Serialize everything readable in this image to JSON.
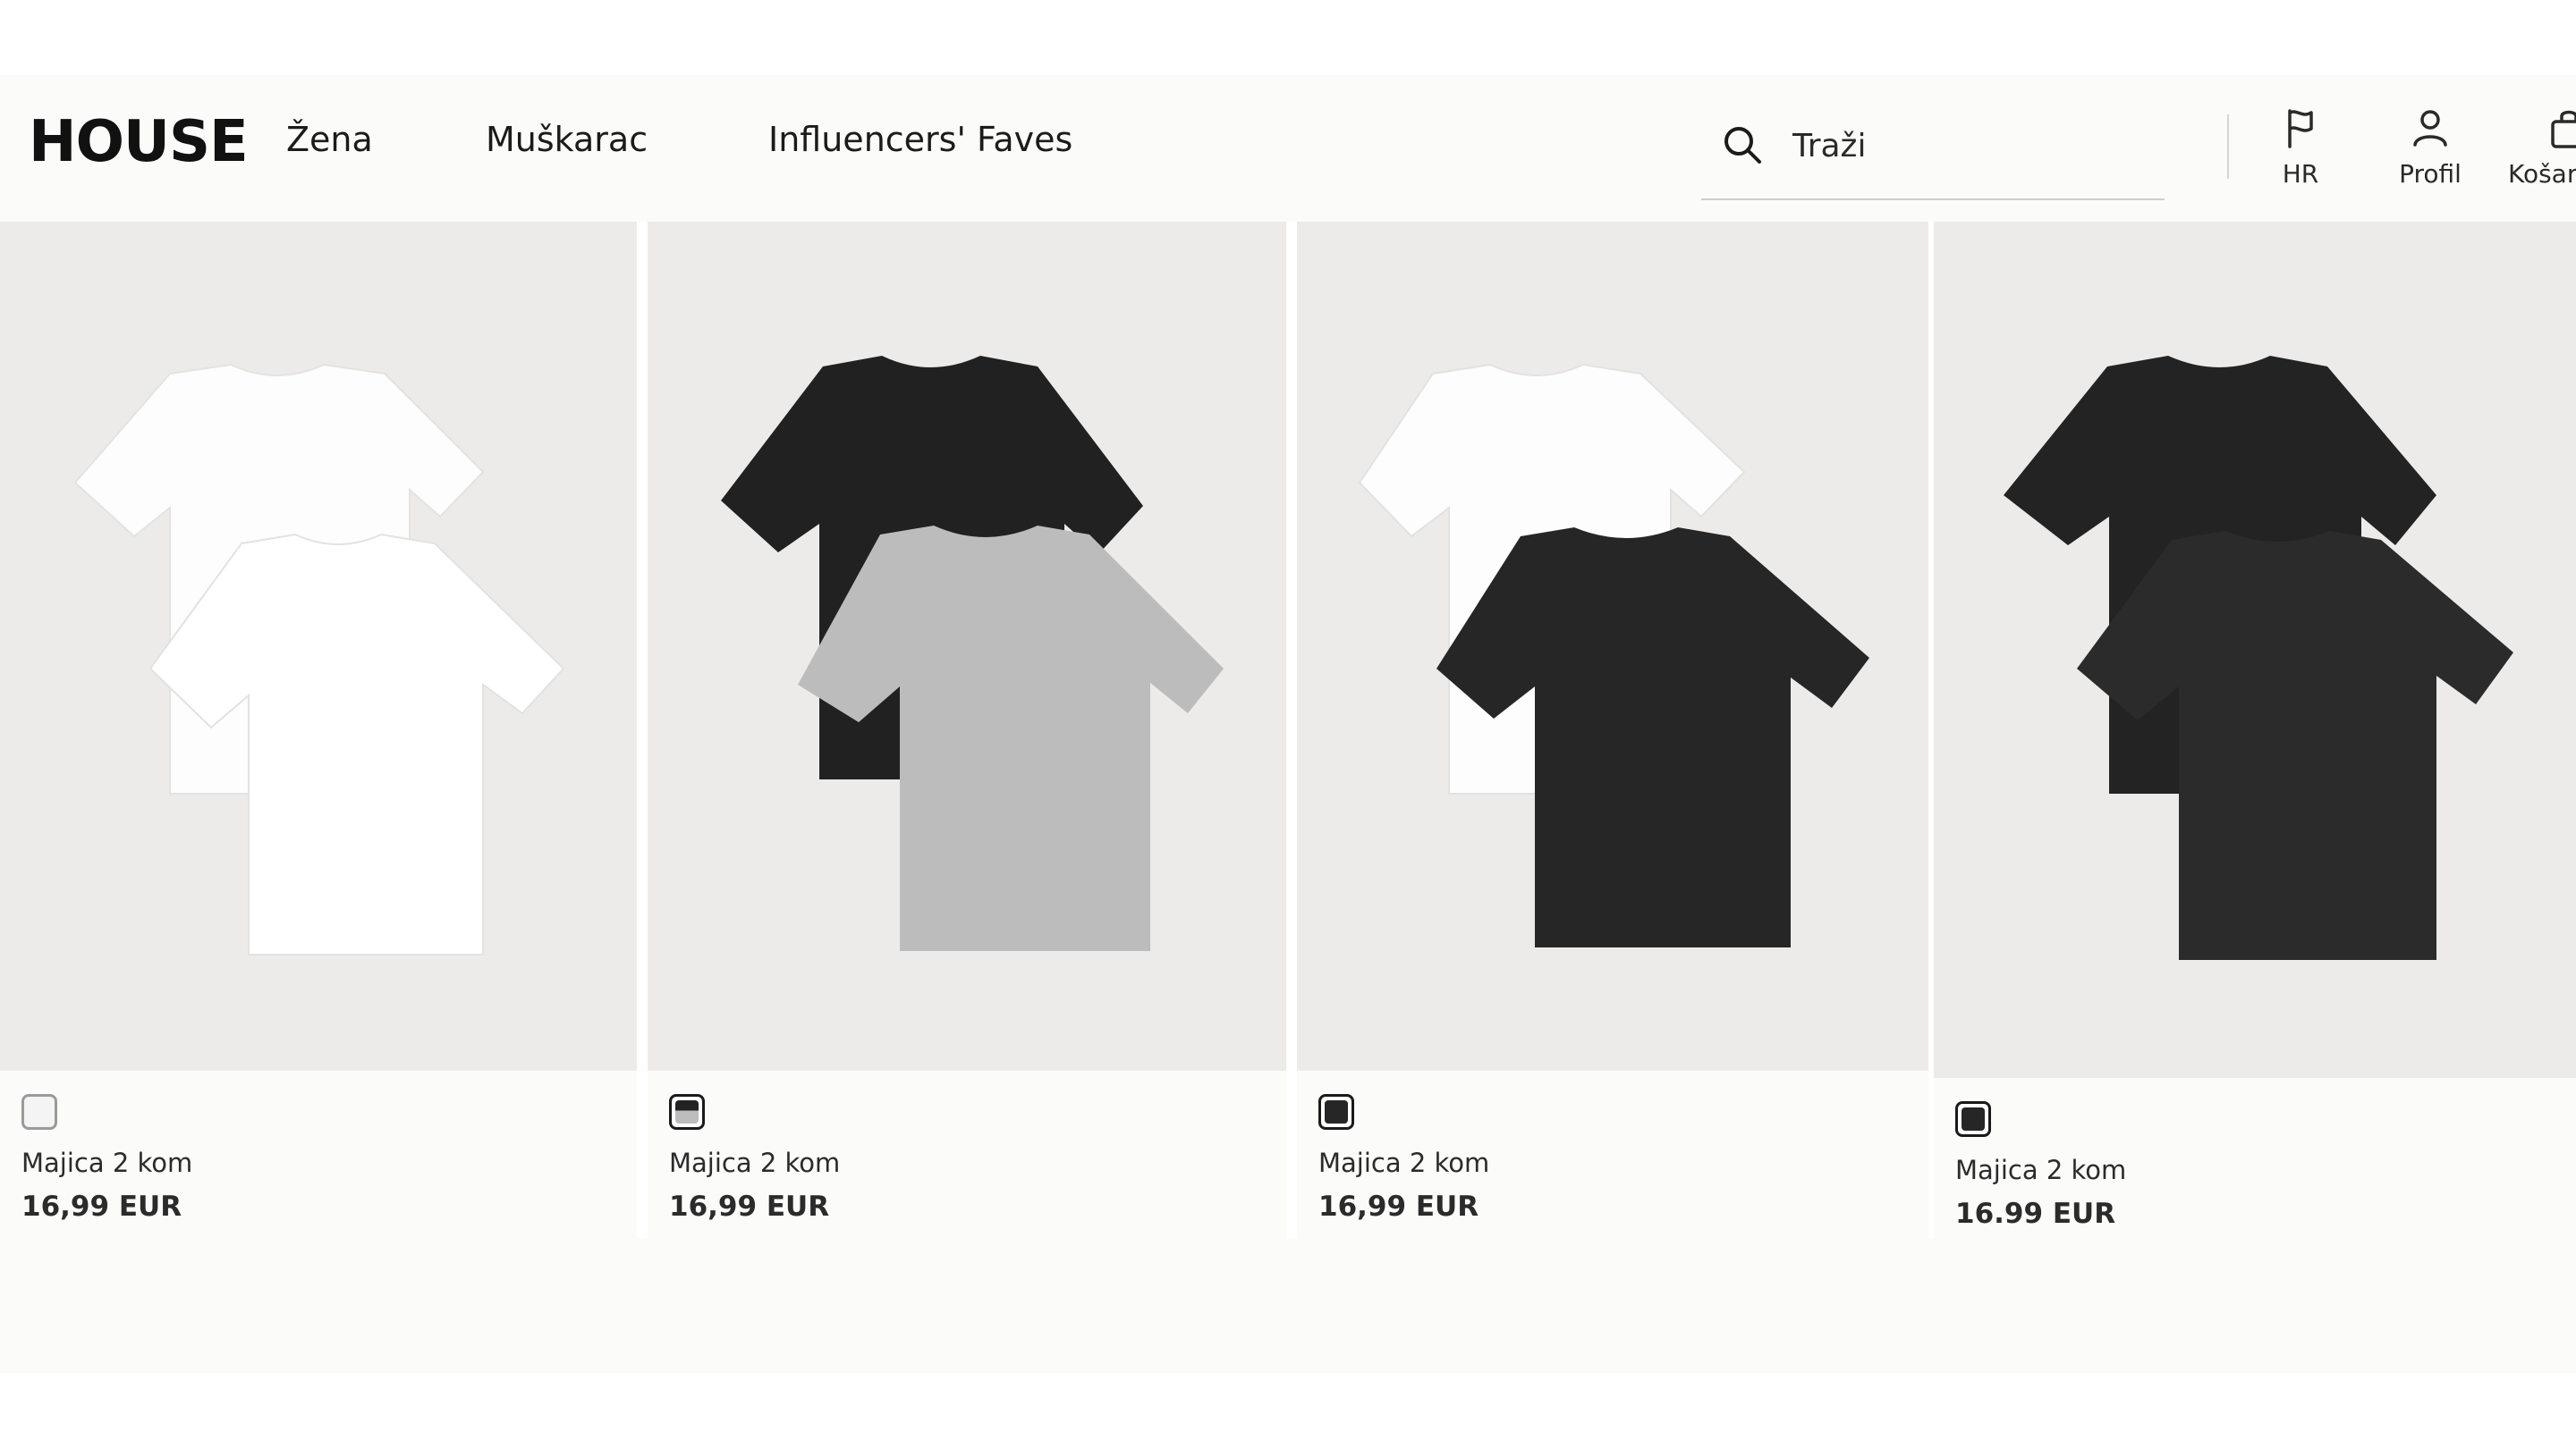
{
  "header": {
    "logo": "HOUSE",
    "nav": [
      "Žena",
      "Muškarac",
      "Influencers' Faves"
    ],
    "search_placeholder": "Traži",
    "country_label": "HR",
    "profile_label": "Profil",
    "cart_label": "Košar"
  },
  "products": [
    {
      "name": "Majica 2 kom",
      "price": "16,99 EUR",
      "swatch": "white",
      "colors": [
        "#ffffff",
        "#ffffff"
      ]
    },
    {
      "name": "Majica 2 kom",
      "price": "16,99 EUR",
      "swatch": "black-grey",
      "colors": [
        "#222222",
        "#bdbdbd"
      ]
    },
    {
      "name": "Majica 2 kom",
      "price": "16,99 EUR",
      "swatch": "black",
      "colors": [
        "#ffffff",
        "#262626"
      ]
    },
    {
      "name": "Majica 2 kom",
      "price": "16.99 EUR",
      "swatch": "black",
      "colors": [
        "#232323",
        "#2b2b2b"
      ]
    }
  ],
  "icons": {
    "search": "search-icon",
    "country": "flag-icon",
    "profile": "user-icon",
    "cart": "bag-icon"
  },
  "colors": {
    "background": "#fbfbfa",
    "photo_background": "#ecebe9",
    "text": "#1e1e1e"
  }
}
